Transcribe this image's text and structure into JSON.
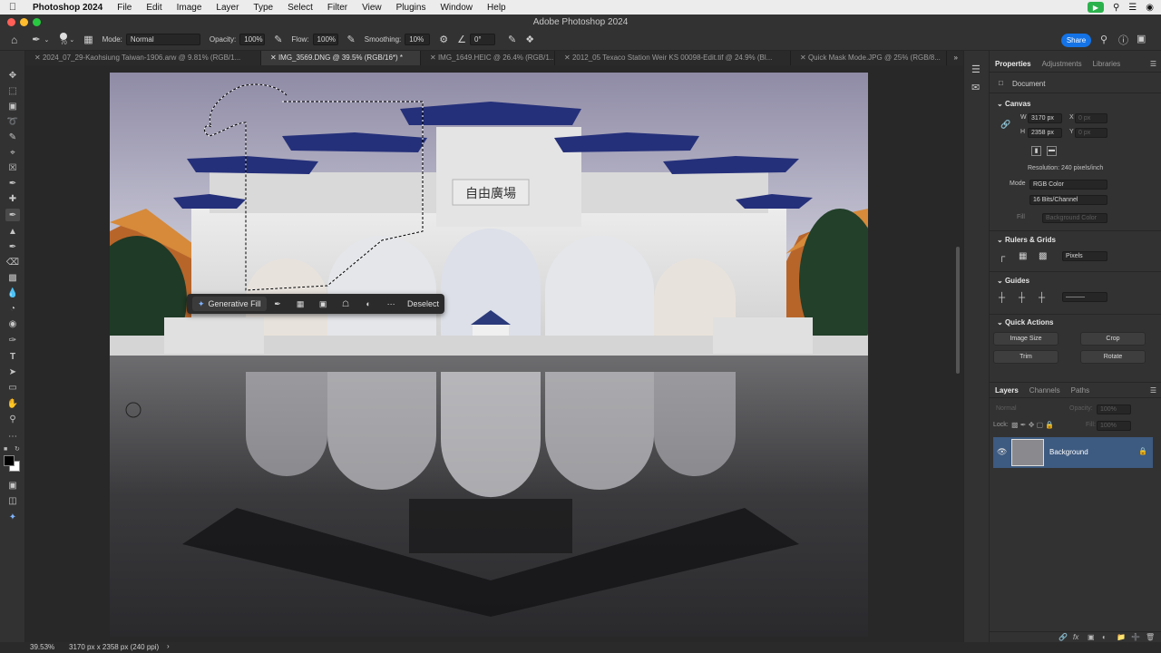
{
  "menubar": {
    "app_name": "Photoshop 2024",
    "items": [
      "File",
      "Edit",
      "Image",
      "Layer",
      "Type",
      "Select",
      "Filter",
      "View",
      "Plugins",
      "Window",
      "Help"
    ]
  },
  "window": {
    "title": "Adobe Photoshop 2024"
  },
  "options": {
    "brush_size": "70",
    "mode_label": "Mode:",
    "mode_value": "Normal",
    "opacity_label": "Opacity:",
    "opacity_value": "100%",
    "flow_label": "Flow:",
    "flow_value": "100%",
    "smoothing_label": "Smoothing:",
    "smoothing_value": "10%",
    "angle_value": "0°",
    "share_label": "Share"
  },
  "tabs": [
    "2024_07_29-Kaohsiung Taiwan-1906.arw @ 9.81% (RGB/1...",
    "IMG_3569.DNG @ 39.5% (RGB/16*) *",
    "IMG_1649.HEIC @ 26.4% (RGB/1...",
    "2012_05 Texaco Station Weir KS 00098-Edit.tif @ 24.9% (Bl...",
    "Quick Mask Mode.JPG @ 25% (RGB/8..."
  ],
  "context_bar": {
    "generative_fill": "Generative Fill",
    "deselect": "Deselect"
  },
  "properties": {
    "tabs": [
      "Properties",
      "Adjustments",
      "Libraries"
    ],
    "document_label": "Document",
    "canvas_header": "Canvas",
    "w_label": "W",
    "w_value": "3170 px",
    "h_label": "H",
    "h_value": "2358 px",
    "x_label": "X",
    "x_placeholder": "0 px",
    "y_label": "Y",
    "y_placeholder": "0 px",
    "resolution": "Resolution: 240 pixels/inch",
    "mode_label": "Mode",
    "mode_value": "RGB Color",
    "bits_value": "16 Bits/Channel",
    "fill_label": "Fill",
    "fill_value": "Background Color",
    "rulers_header": "Rulers & Grids",
    "units_value": "Pixels",
    "guides_header": "Guides",
    "quick_actions_header": "Quick Actions",
    "image_size": "Image Size",
    "crop": "Crop",
    "trim": "Trim",
    "rotate": "Rotate"
  },
  "layers": {
    "tabs": [
      "Layers",
      "Channels",
      "Paths"
    ],
    "blend_mode": "Normal",
    "opacity_label": "Opacity:",
    "opacity_value": "100%",
    "lock_label": "Lock:",
    "fill_label": "Fill:",
    "fill_value": "100%",
    "layer_name": "Background"
  },
  "status": {
    "zoom": "39.53%",
    "doc_info": "3170 px x 2358 px (240 ppi)"
  },
  "colors": {
    "accent": "#1473e6",
    "layer_selected": "#3d5a80",
    "active_green": "#2bb24c"
  },
  "photo_text": {
    "plaque": "自由廣場"
  }
}
